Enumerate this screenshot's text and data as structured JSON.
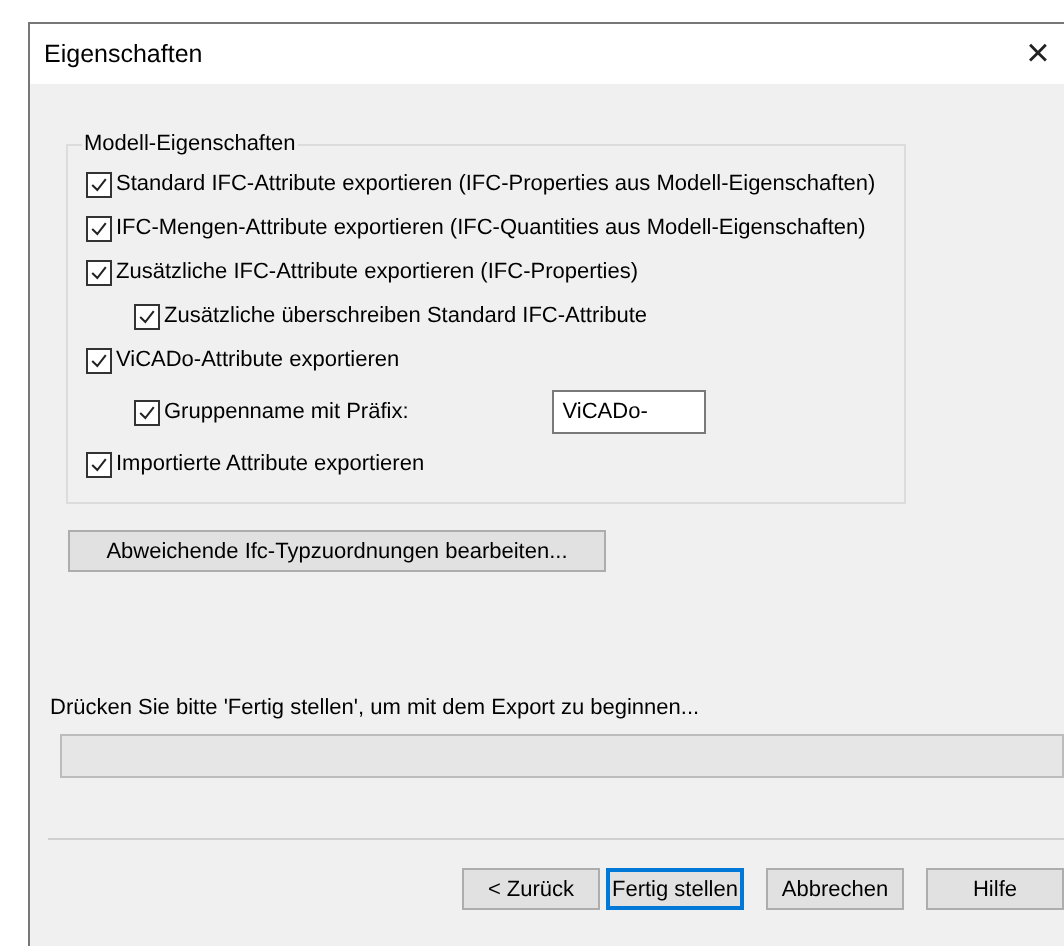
{
  "window": {
    "title": "Eigenschaften",
    "close": "×"
  },
  "group": {
    "title": "Modell-Eigenschaften",
    "options": [
      {
        "label": "Standard IFC-Attribute exportieren (IFC-Properties aus Modell-Eigenschaften)",
        "checked": true
      },
      {
        "label": "IFC-Mengen-Attribute exportieren (IFC-Quantities aus Modell-Eigenschaften)",
        "checked": true
      },
      {
        "label": "Zusätzliche IFC-Attribute exportieren (IFC-Properties)",
        "checked": true,
        "children": [
          {
            "label": "Zusätzliche überschreiben Standard IFC-Attribute",
            "checked": true
          }
        ]
      },
      {
        "label": "ViCADo-Attribute exportieren",
        "checked": true,
        "children": [
          {
            "label": "Gruppenname mit Präfix:",
            "checked": true,
            "field": {
              "value": "ViCADo-"
            }
          }
        ]
      },
      {
        "label": "Importierte Attribute exportieren",
        "checked": true
      }
    ]
  },
  "mapping_button": "Abweichende Ifc-Typzuordnungen bearbeiten...",
  "status": {
    "text": "Drücken Sie bitte 'Fertig stellen', um mit dem Export zu beginnen...",
    "level": 0
  },
  "buttons": [
    {
      "label": "< Zurück",
      "default": false
    },
    {
      "label": "Fertig stellen",
      "default": true
    },
    {
      "label": "Abbrechen",
      "default": false
    },
    {
      "label": "Hilfe",
      "default": false
    }
  ]
}
